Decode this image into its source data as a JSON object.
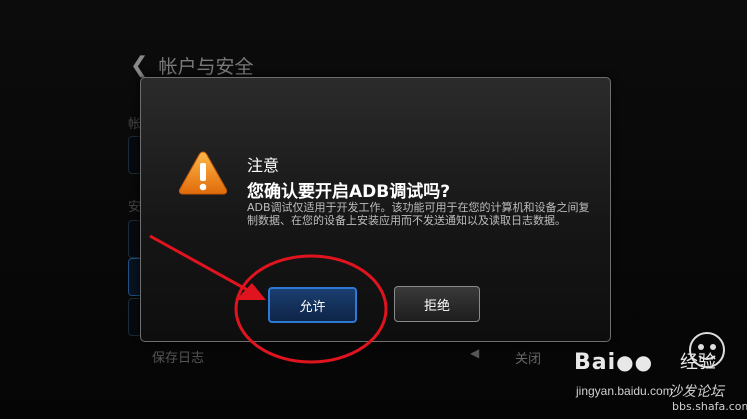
{
  "background": {
    "header_title": "帐户与安全",
    "section_account": "帐户",
    "section_security": "安",
    "save_log_label": "保存日志",
    "save_log_value": "关闭"
  },
  "dialog": {
    "title": "注意",
    "question": "您确认要开启ADB调试吗?",
    "body": "ADB调试仅适用于开发工作。该功能可用于在您的计算机和设备之间复制数据、在您的设备上安装应用而不发送通知以及读取日志数据。",
    "allow_label": "允许",
    "deny_label": "拒绝"
  },
  "watermark": {
    "logo": "Bai",
    "logo_cn": "经验",
    "url": "jingyan.baidu.com",
    "tag": "沙发论坛",
    "site": "bbs.shafa.com"
  },
  "colors": {
    "accent_blue": "#2d7ad6",
    "annotation_red": "#e0141e",
    "warning_orange": "#f08a17"
  }
}
